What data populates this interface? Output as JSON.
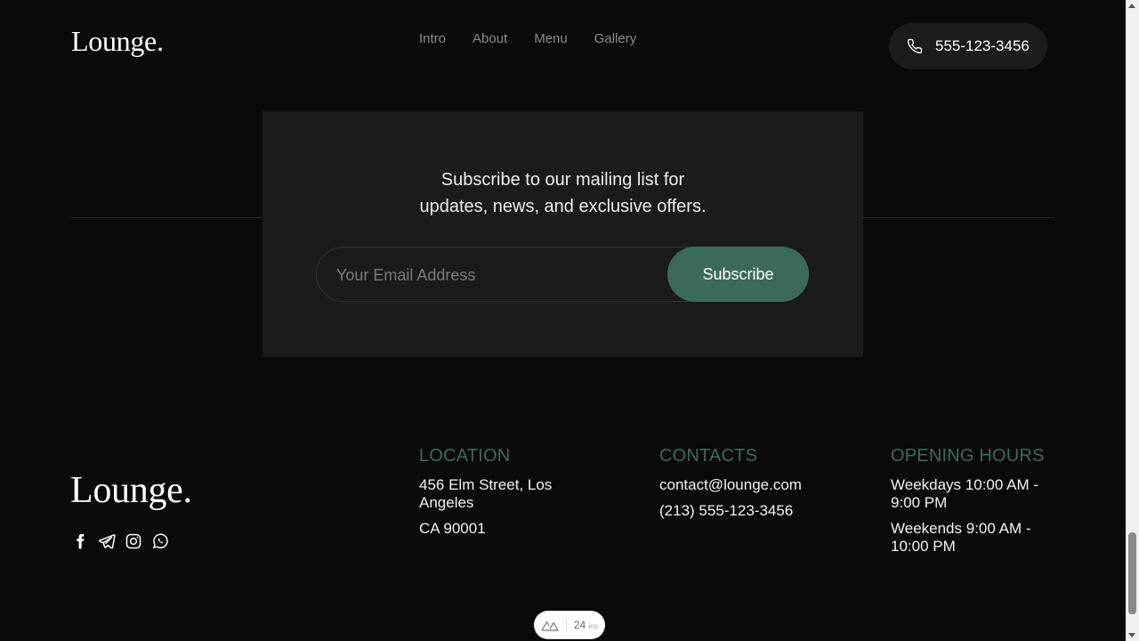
{
  "header": {
    "logo": "Lounge.",
    "nav": [
      "Intro",
      "About",
      "Menu",
      "Gallery"
    ],
    "phone": "555-123-3456"
  },
  "subscribe": {
    "line1": "Subscribe to our mailing list for",
    "line2": "updates, news, and exclusive offers.",
    "email_placeholder": "Your Email Address",
    "button": "Subscribe"
  },
  "footer": {
    "logo": "Lounge.",
    "socials": [
      "facebook-icon",
      "telegram-icon",
      "instagram-icon",
      "whatsapp-icon"
    ],
    "location": {
      "title": "LOCATION",
      "line1": "456 Elm Street, Los Angeles",
      "line2": "CA 90001"
    },
    "contacts": {
      "title": "CONTACTS",
      "email": "contact@lounge.com",
      "phone": "(213) 555-123-3456"
    },
    "hours": {
      "title": "OPENING HOURS",
      "weekdays": "Weekdays 10:00 AM - 9:00 PM",
      "weekends": "Weekends 9:00 AM - 10:00 PM"
    }
  },
  "dev_badge": {
    "value": "24",
    "unit": "ms"
  },
  "colors": {
    "accent": "#3b6b58",
    "background": "#0a0a0a",
    "card": "#1b1b1b"
  }
}
